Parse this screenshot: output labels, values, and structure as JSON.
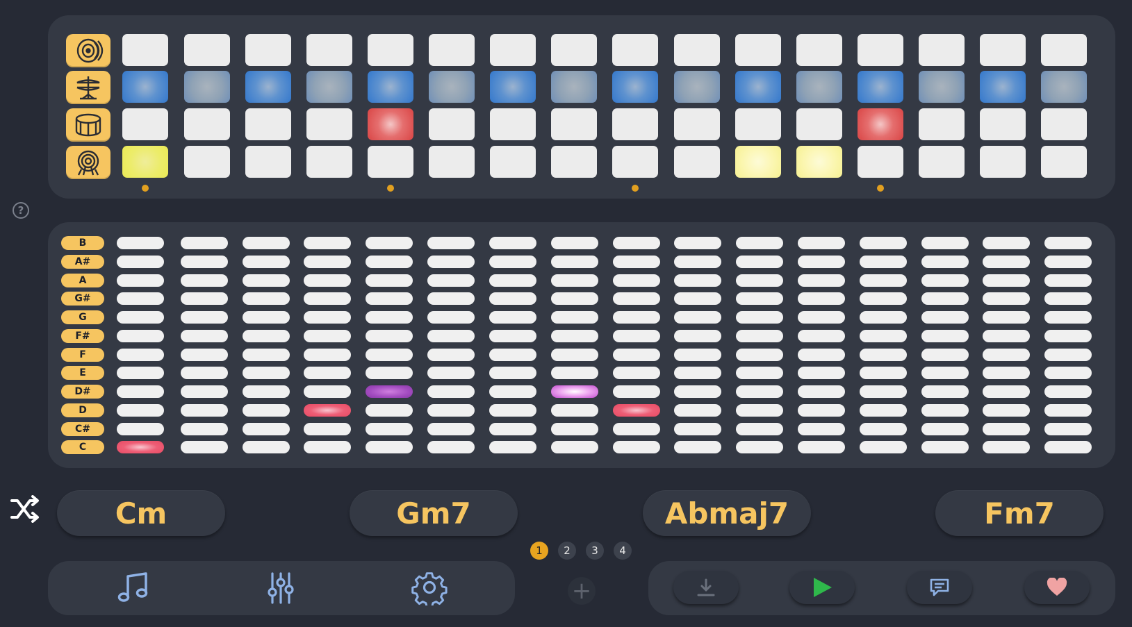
{
  "colors": {
    "background": "#262a35",
    "panel": "#343944",
    "accent_yellow": "#f6c560",
    "play_green": "#2fb84b",
    "heart_pink": "#f0a3a3",
    "beat_dot": "#e2a020"
  },
  "drum_machine": {
    "instruments": [
      {
        "icon": "speaker-icon"
      },
      {
        "icon": "hi-hat-icon"
      },
      {
        "icon": "snare-drum-icon"
      },
      {
        "icon": "kick-drum-icon"
      }
    ],
    "steps": 16,
    "rows": [
      {
        "active": []
      },
      {
        "active": [
          0,
          1,
          2,
          3,
          4,
          5,
          6,
          7,
          8,
          9,
          10,
          11,
          12,
          13,
          14,
          15
        ],
        "color": "blue"
      },
      {
        "active": [
          4,
          12
        ],
        "color": "red"
      },
      {
        "active": [
          0,
          10,
          11
        ],
        "color": "yellow"
      }
    ],
    "beat_markers": [
      0,
      4,
      8,
      12
    ]
  },
  "melody_grid": {
    "notes": [
      "B",
      "A#",
      "A",
      "G#",
      "G",
      "F#",
      "F",
      "E",
      "D#",
      "D",
      "C#",
      "C"
    ],
    "steps": 16,
    "active": [
      {
        "note": "C",
        "step": 0,
        "color": "red"
      },
      {
        "note": "D",
        "step": 3,
        "color": "red"
      },
      {
        "note": "D#",
        "step": 4,
        "color": "purple"
      },
      {
        "note": "D#",
        "step": 7,
        "color": "magenta"
      },
      {
        "note": "D",
        "step": 8,
        "color": "red"
      }
    ]
  },
  "help": {
    "label": "?"
  },
  "shuffle": {
    "icon": "shuffle-icon"
  },
  "chords": [
    "Cm",
    "Gm7",
    "Abmaj7",
    "Fm7"
  ],
  "patterns": {
    "pages": [
      "1",
      "2",
      "3",
      "4"
    ],
    "active": "1",
    "add_icon": "plus-icon",
    "add_label": "+"
  },
  "tools": [
    {
      "icon": "music-note-icon"
    },
    {
      "icon": "sliders-icon"
    },
    {
      "icon": "gear-icon"
    }
  ],
  "transport": [
    {
      "icon": "download-icon"
    },
    {
      "icon": "play-icon"
    },
    {
      "icon": "comment-icon"
    },
    {
      "icon": "heart-icon"
    }
  ]
}
